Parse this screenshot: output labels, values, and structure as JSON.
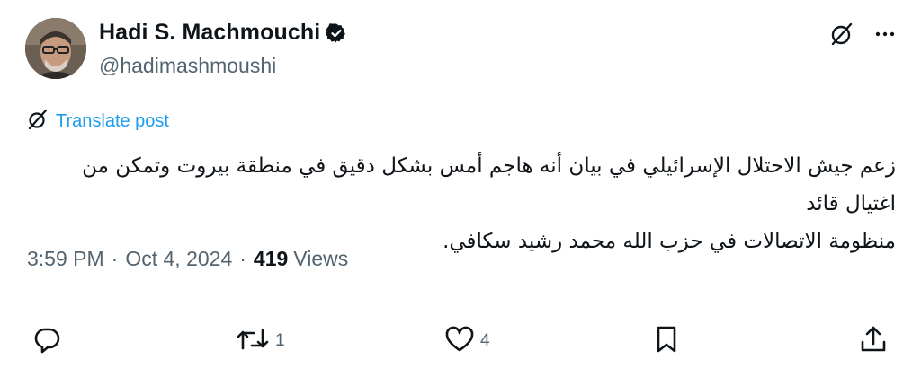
{
  "author": {
    "display_name": "Hadi S. Machmouchi",
    "handle": "@hadimashmoushi",
    "verified": true,
    "verified_color": "#0f1419"
  },
  "icons": {
    "avatar": "avatar",
    "verified": "verified-badge-icon",
    "grok": "grok-icon",
    "more": "more-options-icon",
    "reply": "reply-icon",
    "repost": "repost-icon",
    "like": "like-icon",
    "bookmark": "bookmark-icon",
    "share": "share-icon"
  },
  "translate": {
    "label": "Translate post",
    "color": "#1d9bf0"
  },
  "tweet": {
    "line1": "زعم جيش الاحتلال الإسرائيلي في بيان أنه هاجم أمس بشكل دقيق في منطقة بيروت وتمكن من اغتيال قائد",
    "line2": "منظومة الاتصالات في حزب الله محمد رشيد سكافي."
  },
  "meta": {
    "time": "3:59 PM",
    "dot": "·",
    "date": "Oct 4, 2024",
    "views_count": "419",
    "views_label": "Views"
  },
  "actions": {
    "replies": "",
    "reposts": "1",
    "likes": "4"
  }
}
